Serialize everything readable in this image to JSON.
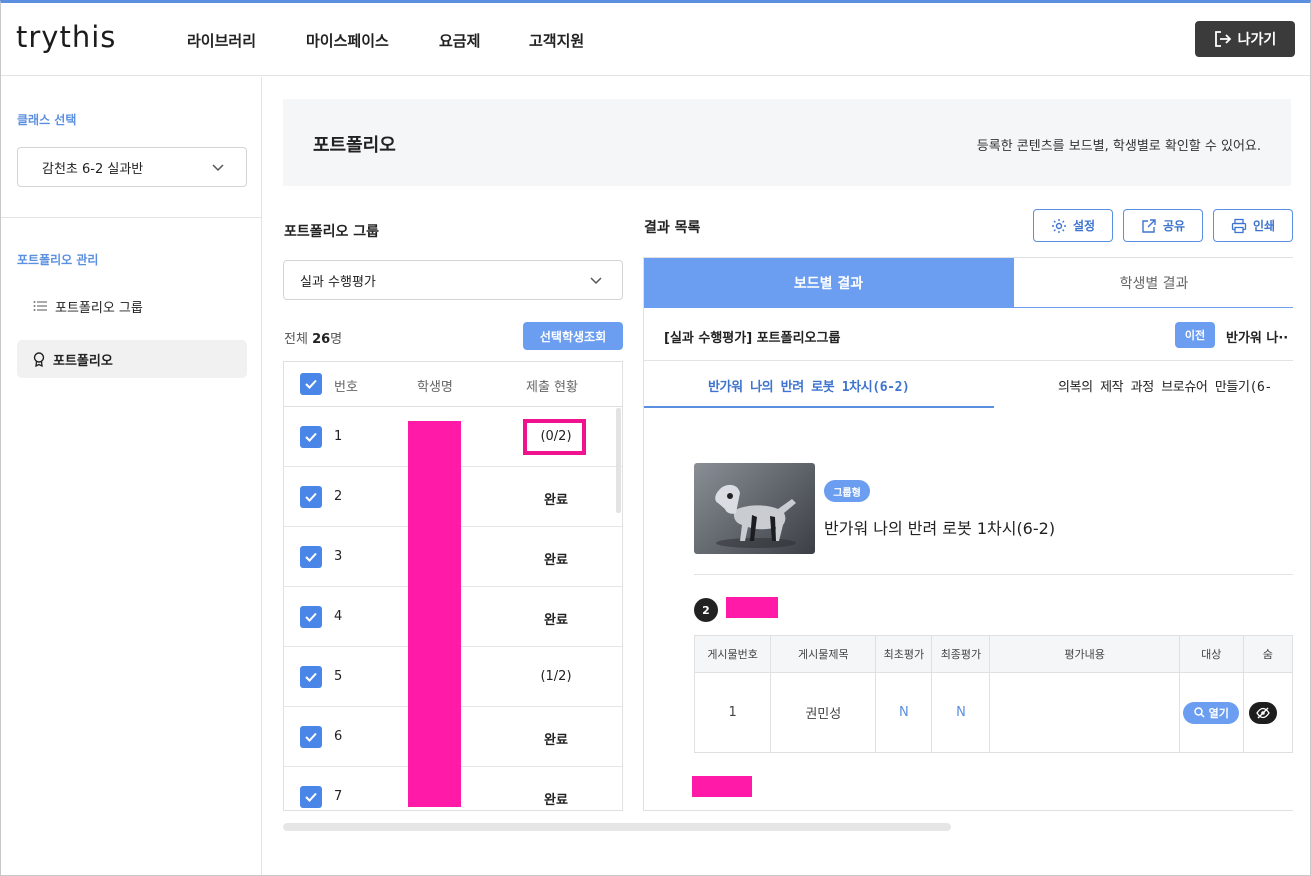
{
  "app": {
    "logo": "trythis"
  },
  "nav": {
    "items": [
      "라이브러리",
      "마이스페이스",
      "요금제",
      "고객지원"
    ],
    "exit_label": "나가기"
  },
  "sidebar": {
    "class_section_title": "클래스 선택",
    "class_selected": "감천초 6-2 실과반",
    "portfolio_section_title": "포트폴리오 관리",
    "links": [
      {
        "label": "포트폴리오 그룹",
        "icon": "list-icon"
      },
      {
        "label": "포트폴리오",
        "icon": "award-icon"
      }
    ]
  },
  "banner": {
    "title": "포트폴리오",
    "description": "등록한 콘텐츠를 보드별, 학생별로 확인할 수 있어요."
  },
  "left_panel": {
    "title": "포트폴리오 그룹",
    "group_selected": "실과 수행평가",
    "total_prefix": "전체",
    "total_count": "26",
    "total_suffix": "명",
    "query_button": "선택학생조회",
    "columns": [
      "번호",
      "학생명",
      "제출 현황"
    ],
    "rows": [
      {
        "num": "1",
        "status": "(0/2)"
      },
      {
        "num": "2",
        "status": "완료"
      },
      {
        "num": "3",
        "status": "완료"
      },
      {
        "num": "4",
        "status": "완료"
      },
      {
        "num": "5",
        "status": "(1/2)"
      },
      {
        "num": "6",
        "status": "완료"
      },
      {
        "num": "7",
        "status": "완료"
      }
    ]
  },
  "right_panel": {
    "title": "결과 목록",
    "tools": {
      "settings": "설정",
      "share": "공유",
      "print": "인쇄"
    },
    "tabs": {
      "board": "보드별 결과",
      "student": "학생별 결과"
    },
    "crumb": "[실과 수행평가] 포트폴리오그룹",
    "prev_button": "이전",
    "next_label": "반가워 나··",
    "subtabs": [
      "반가워 나의 반려 로봇 1차시(6-2)",
      "의복의 제작 과정 브로슈어 만들기(6-"
    ],
    "board": {
      "badge": "그룹형",
      "title": "반가워 나의 반려 로봇 1차시(6-2)",
      "count": "2"
    },
    "table": {
      "columns": [
        "게시물번호",
        "게시물제목",
        "최초평가",
        "최종평가",
        "평가내용",
        "대상",
        "숨"
      ],
      "row": {
        "no": "1",
        "title": "권민성",
        "first": "N",
        "final": "N",
        "content": "",
        "open_label": "열기"
      }
    }
  },
  "colors": {
    "accent": "#6b9ef0",
    "highlight": "#ff1aa8",
    "dark": "#3b3b3b"
  }
}
